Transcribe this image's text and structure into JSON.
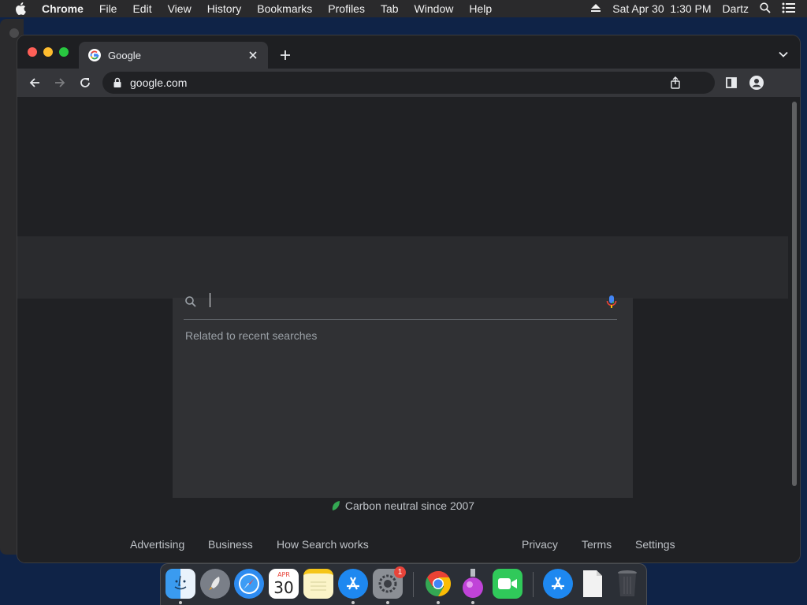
{
  "menubar": {
    "app_name": "Chrome",
    "items": [
      "File",
      "Edit",
      "View",
      "History",
      "Bookmarks",
      "Profiles",
      "Tab",
      "Window",
      "Help"
    ],
    "datetime": "Sat Apr 30  1:30 PM",
    "user": "Dartz"
  },
  "browser": {
    "tab_title": "Google",
    "url": "google.com"
  },
  "page": {
    "suggestions_heading": "Related to recent searches",
    "carbon_text": "Carbon neutral since 2007",
    "footer_left": [
      "Advertising",
      "Business",
      "How Search works"
    ],
    "footer_right": [
      "Privacy",
      "Terms",
      "Settings"
    ]
  },
  "dock": {
    "apps": [
      "finder-icon",
      "launchpad-icon",
      "safari-icon",
      "calendar-icon",
      "notes-icon",
      "app-store-icon",
      "system-preferences-icon",
      "chrome-icon",
      "app-icon",
      "facetime-icon",
      "app-store-icon",
      "file-icon",
      "trash-icon"
    ],
    "calendar_month": "APR",
    "calendar_day": "30",
    "preferences_badge": "1"
  }
}
